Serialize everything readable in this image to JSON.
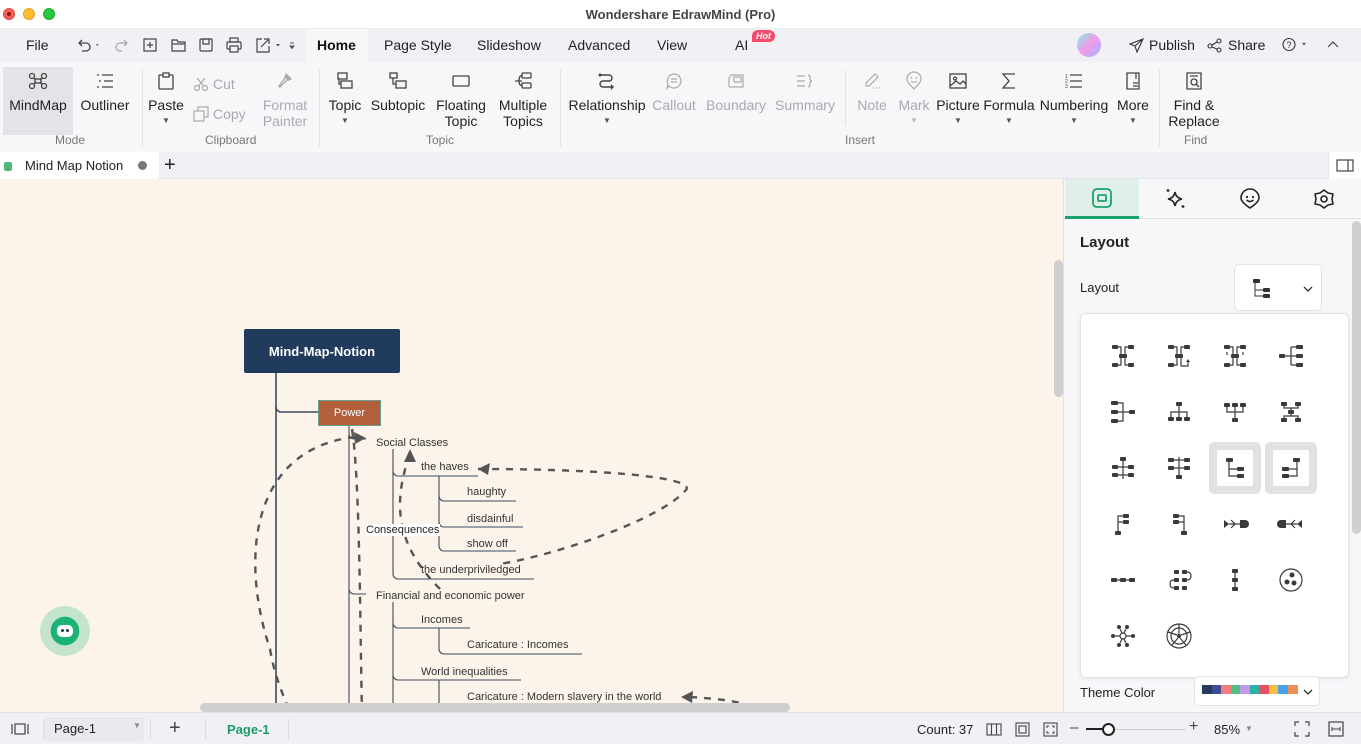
{
  "app": {
    "title": "Wondershare EdrawMind (Pro)"
  },
  "menubar": {
    "file": "File",
    "tabs": [
      "Home",
      "Page Style",
      "Slideshow",
      "Advanced",
      "View",
      "AI"
    ],
    "ai_badge": "Hot",
    "publish": "Publish",
    "share": "Share",
    "quick_access_icons": [
      "undo-icon",
      "redo-icon",
      "new-icon",
      "open-icon",
      "save-icon",
      "print-icon",
      "export-icon",
      "customize-icon"
    ]
  },
  "ribbon": {
    "mode": {
      "label": "Mode",
      "mindmap": "MindMap",
      "outliner": "Outliner"
    },
    "clipboard": {
      "label": "Clipboard",
      "paste": "Paste",
      "cut": "Cut",
      "copy": "Copy",
      "format_painter_1": "Format",
      "format_painter_2": "Painter"
    },
    "topic": {
      "label": "Topic",
      "topic": "Topic",
      "subtopic": "Subtopic",
      "floating_1": "Floating",
      "floating_2": "Topic",
      "multiple_1": "Multiple",
      "multiple_2": "Topics"
    },
    "insert": {
      "label": "Insert",
      "relationship": "Relationship",
      "callout": "Callout",
      "boundary": "Boundary",
      "summary": "Summary",
      "note": "Note",
      "mark": "Mark",
      "picture": "Picture",
      "formula": "Formula",
      "numbering": "Numbering",
      "more": "More"
    },
    "find": {
      "label": "Find",
      "find_1": "Find &",
      "find_2": "Replace"
    }
  },
  "document_tab": {
    "name": "Mind Map Notion",
    "unsaved": true
  },
  "mindmap": {
    "root": "Mind-Map-Notion",
    "main_topic": "Power",
    "nodes": {
      "social_classes": "Social Classes",
      "the_haves": "the haves",
      "haughty": "haughty",
      "disdainful": "disdainful",
      "show_off": "show off",
      "underprivileged": "the underpriviledged",
      "financial": "Financial and economic power",
      "incomes": "Incomes",
      "caricature_incomes": "Caricature : Incomes",
      "world_inequalities": "World inequalities",
      "caricature_slavery": "Caricature : Modern slavery in the world"
    },
    "relationship_label": "Consequences"
  },
  "right_panel": {
    "tabs": [
      "layout-tab",
      "style-tab",
      "icon-tab",
      "theme-tab"
    ],
    "section_title": "Layout",
    "layout_label": "Layout",
    "layout_options": [
      "mind-map",
      "mind-map-clockwise",
      "mind-map-balanced",
      "right-map",
      "left-map",
      "org-chart-down",
      "org-chart-up",
      "horizontal-tree",
      "tree-table-center",
      "tree-table-both",
      "tree-right",
      "tree-left",
      "tree-right-up",
      "tree-left-up",
      "fishbone-right",
      "fishbone-left",
      "timeline-horizontal",
      "timeline-winding",
      "timeline-vertical",
      "bubble",
      "sector",
      "circular"
    ],
    "selected_layout": "tree-right",
    "theme_color_label": "Theme Color",
    "theme_colors": [
      "#263a5c",
      "#3f4e94",
      "#f27f7e",
      "#4fbf85",
      "#c39ae6",
      "#2cb3a5",
      "#e94f64",
      "#f2bf3e",
      "#4aa3e8",
      "#ef8d5b"
    ]
  },
  "statusbar": {
    "page_select": "Page-1",
    "active_page": "Page-1",
    "count": "Count: 37",
    "zoom": "85%",
    "zoom_fraction": 0.22
  },
  "colors": {
    "accent": "#1aa36c",
    "root": "#213b5c",
    "main_topic": "#b25f3c",
    "canvas": "#fcf4ea"
  }
}
